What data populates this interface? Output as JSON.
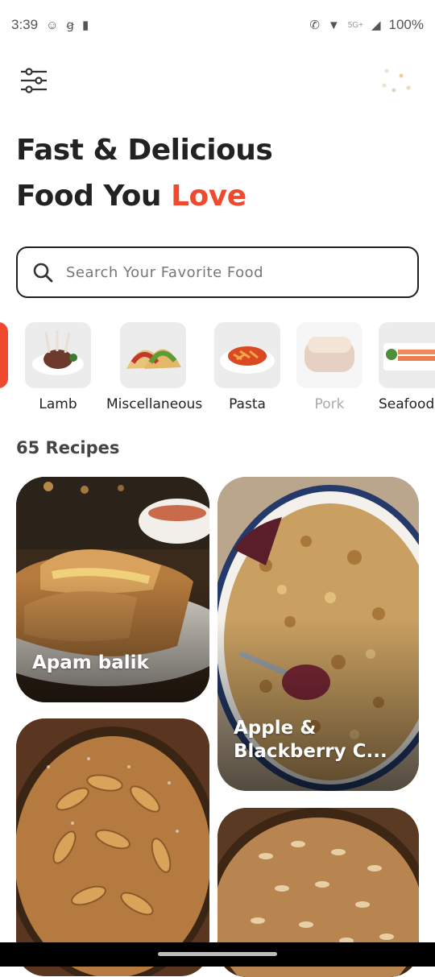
{
  "status_bar": {
    "time": "3:39",
    "network": "5G+",
    "battery": "100%"
  },
  "header": {
    "filter_icon": "sliders-icon",
    "logo_icon": "dotted-logo-icon"
  },
  "headline": {
    "line1": "Fast & Delicious",
    "line2_prefix": "Food You ",
    "line2_accent": "Love",
    "accent_color": "#f04a2e"
  },
  "search": {
    "placeholder": "Search Your Favorite Food"
  },
  "categories": [
    {
      "label": "Lamb"
    },
    {
      "label": "Miscellaneous"
    },
    {
      "label": "Pasta"
    },
    {
      "label": "Pork"
    },
    {
      "label": "Seafood"
    }
  ],
  "recipes_count_label": "65 Recipes",
  "recipes": [
    {
      "name": "Apam balik"
    },
    {
      "name": "Apple & Blackberry C..."
    },
    {
      "name": ""
    },
    {
      "name": ""
    }
  ]
}
